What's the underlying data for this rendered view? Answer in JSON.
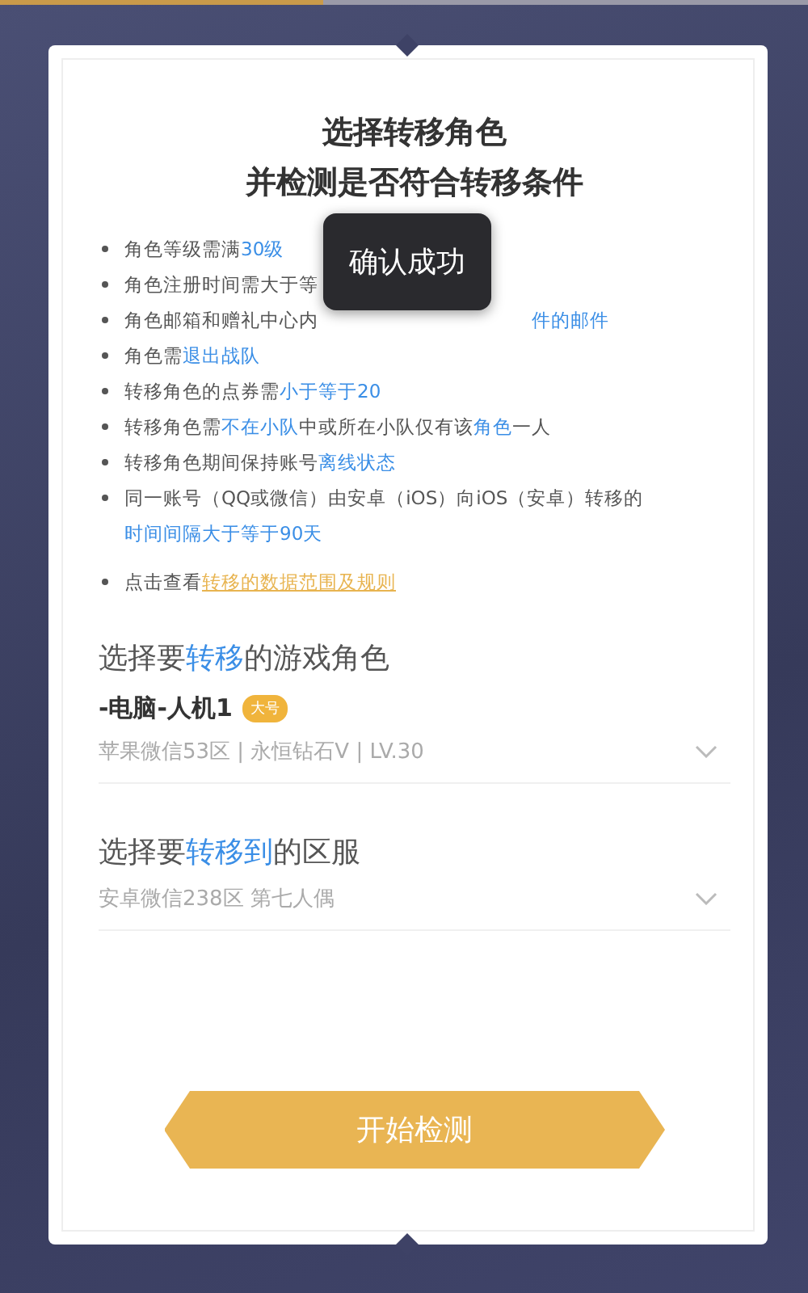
{
  "title_lines": [
    "选择转移角色",
    "并检测是否符合转移条件"
  ],
  "rules": [
    {
      "covered": false,
      "segments": [
        {
          "kind": "plain",
          "text": "角色等级需满"
        },
        {
          "kind": "link",
          "text": "30级"
        }
      ]
    },
    {
      "covered": false,
      "segments": [
        {
          "kind": "plain",
          "text": "角色注册时间需大于等"
        }
      ]
    },
    {
      "covered": true,
      "segments": [
        {
          "kind": "plain",
          "text": "角色邮箱和赠礼中心内"
        },
        {
          "kind": "link",
          "text": "件的邮件"
        }
      ]
    },
    {
      "covered": false,
      "segments": [
        {
          "kind": "plain",
          "text": "角色需"
        },
        {
          "kind": "link",
          "text": "退出战队"
        }
      ]
    },
    {
      "covered": false,
      "segments": [
        {
          "kind": "plain",
          "text": "转移角色的点券需"
        },
        {
          "kind": "link",
          "text": "小于等于20"
        }
      ]
    },
    {
      "covered": false,
      "segments": [
        {
          "kind": "plain",
          "text": "转移角色需"
        },
        {
          "kind": "link",
          "text": "不在小队"
        },
        {
          "kind": "plain",
          "text": "中或所在小队仅有该"
        },
        {
          "kind": "link",
          "text": "角色"
        },
        {
          "kind": "plain",
          "text": "一人"
        }
      ]
    },
    {
      "covered": false,
      "segments": [
        {
          "kind": "plain",
          "text": "转移角色期间保持账号"
        },
        {
          "kind": "link",
          "text": "离线状态"
        }
      ]
    },
    {
      "covered": false,
      "segments": [
        {
          "kind": "plain",
          "text": "同一账号（QQ或微信）由安卓（iOS）向iOS（安卓）转移的"
        },
        {
          "kind": "link",
          "text": "时间间隔大于等于90天"
        }
      ]
    },
    {
      "covered": false,
      "segments": [
        {
          "kind": "plain",
          "text": "点击查看 "
        },
        {
          "kind": "rule_link",
          "text": "转移的数据范围及规则"
        }
      ]
    }
  ],
  "toast": "确认成功",
  "sections": [
    {
      "heading": [
        {
          "kind": "plain",
          "text": "选择要"
        },
        {
          "kind": "link",
          "text": "转移"
        },
        {
          "kind": "plain",
          "text": "的游戏角色"
        }
      ],
      "name": "-电脑-人机1",
      "badge": "大号",
      "detail": "苹果微信53区 | 永恒钻石V | LV.30"
    },
    {
      "heading": [
        {
          "kind": "plain",
          "text": "选择要"
        },
        {
          "kind": "link",
          "text": "转移到"
        },
        {
          "kind": "plain",
          "text": "的区服"
        }
      ],
      "detail": "安卓微信238区 第七人偶"
    }
  ],
  "button": "开始检测"
}
